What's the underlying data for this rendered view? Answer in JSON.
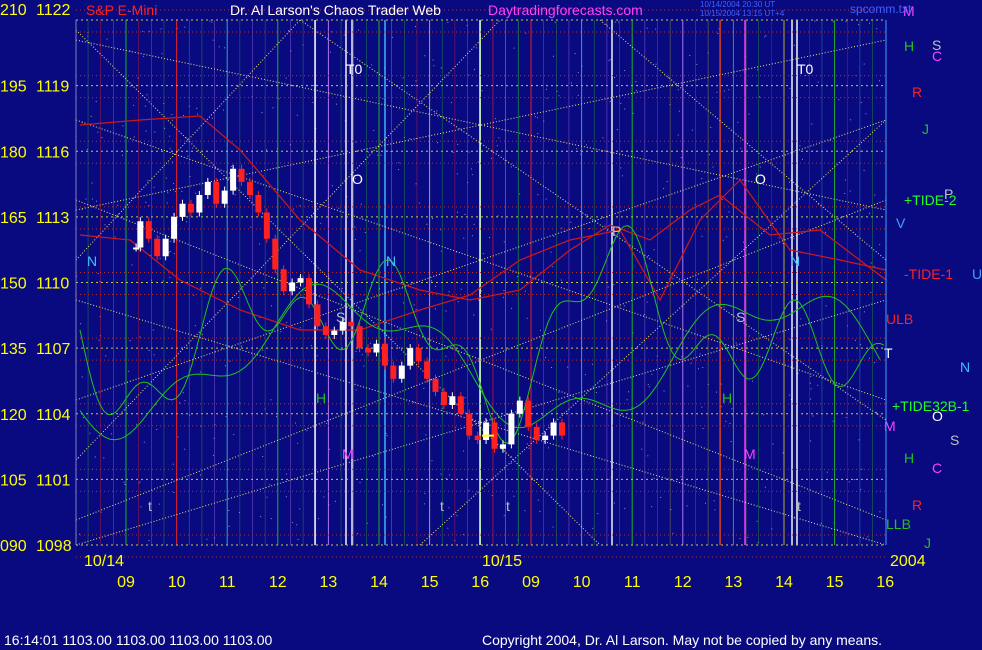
{
  "header": {
    "instrument": "S&P E-Mini",
    "title": "Dr. Al Larson's Chaos Trader Web",
    "site": "Daytradingforecasts.com",
    "file": "spcomm.txt",
    "stamp1": "10/14/2004 20:30 UT",
    "stamp2": "10/15/2004 13:15 UT+4"
  },
  "footer": {
    "quote": "16:14:01  1103.00 1103.00 1103.00 1103.00",
    "copyright": "Copyright 2004, Dr. Al Larson. May not be copied by any means."
  },
  "colors": {
    "background": "#0a0a80",
    "price_up": "#ffffff",
    "price_down": "#ff2020",
    "wave": "#20c020",
    "envelope": "#d01818",
    "diag": "#e8e870",
    "axis_text": "#ffff00"
  },
  "chart_data": {
    "type": "candlestick",
    "y_left_outer": [
      "210",
      "195",
      "180",
      "165",
      "150",
      "135",
      "120",
      "105",
      "090"
    ],
    "y_left_inner": [
      "1122",
      "1119",
      "1116",
      "1113",
      "1110",
      "1107",
      "1104",
      "1101",
      "1098"
    ],
    "ylim": [
      1098,
      1122
    ],
    "date_labels": [
      "10/14",
      "10/15",
      "2004"
    ],
    "hour_ticks": [
      "09",
      "10",
      "11",
      "12",
      "13",
      "14",
      "15",
      "16",
      "09",
      "10",
      "11",
      "12",
      "13",
      "14",
      "15",
      "16"
    ],
    "right_labels": [
      {
        "text": "M",
        "color": "#ff40ff"
      },
      {
        "text": "S",
        "color": "#c0c0c0"
      },
      {
        "text": "H",
        "color": "#20c020"
      },
      {
        "text": "C",
        "color": "#ff40ff"
      },
      {
        "text": "R",
        "color": "#ff2020"
      },
      {
        "text": "J",
        "color": "#20c020"
      },
      {
        "text": "+TIDE-2",
        "color": "#20ff20"
      },
      {
        "text": "P",
        "color": "#c0c0c0"
      },
      {
        "text": "V",
        "color": "#40a0ff"
      },
      {
        "text": "-TIDE-1",
        "color": "#ff2020"
      },
      {
        "text": "U",
        "color": "#40a0ff"
      },
      {
        "text": "ULB",
        "color": "#ff2020"
      },
      {
        "text": "T",
        "color": "#ffffff"
      },
      {
        "text": "N",
        "color": "#40c0ff"
      },
      {
        "text": "+TIDE32B-1",
        "color": "#20ff20"
      },
      {
        "text": "M",
        "color": "#ff40ff"
      },
      {
        "text": "O",
        "color": "#ffffff"
      },
      {
        "text": "S",
        "color": "#c0c0c0"
      },
      {
        "text": "H",
        "color": "#20c020"
      },
      {
        "text": "C",
        "color": "#ff40ff"
      },
      {
        "text": "R",
        "color": "#ff2020"
      },
      {
        "text": "LLB",
        "color": "#20c020"
      },
      {
        "text": "J",
        "color": "#20c020"
      }
    ],
    "in_chart_labels": [
      {
        "text": "T0",
        "color": "#ffffff"
      },
      {
        "text": "T0",
        "color": "#ffffff"
      },
      {
        "text": "O",
        "color": "#ffffff"
      },
      {
        "text": "O",
        "color": "#ffffff"
      },
      {
        "text": "N",
        "color": "#40c0ff"
      },
      {
        "text": "N",
        "color": "#40c0ff"
      },
      {
        "text": "N",
        "color": "#40c0ff"
      },
      {
        "text": "P",
        "color": "#c0c0c0"
      },
      {
        "text": "S",
        "color": "#c0c0c0"
      },
      {
        "text": "S",
        "color": "#c0c0c0"
      },
      {
        "text": "H",
        "color": "#20c020"
      },
      {
        "text": "H",
        "color": "#20c020"
      },
      {
        "text": "M",
        "color": "#ff40ff"
      },
      {
        "text": "M",
        "color": "#ff40ff"
      },
      {
        "text": "t",
        "color": "#c0c0c0"
      },
      {
        "text": "t",
        "color": "#c0c0c0"
      },
      {
        "text": "t",
        "color": "#c0c0c0"
      },
      {
        "text": "t",
        "color": "#c0c0c0"
      }
    ],
    "price_series": [
      [
        "09:30",
        1111.6
      ],
      [
        "09:35",
        1112.8
      ],
      [
        "09:45",
        1112.0
      ],
      [
        "09:55",
        1111.2
      ],
      [
        "10:05",
        1112.0
      ],
      [
        "10:15",
        1113.0
      ],
      [
        "10:25",
        1113.6
      ],
      [
        "10:35",
        1113.2
      ],
      [
        "10:45",
        1114.0
      ],
      [
        "10:55",
        1114.6
      ],
      [
        "11:05",
        1113.6
      ],
      [
        "11:15",
        1114.2
      ],
      [
        "11:25",
        1115.2
      ],
      [
        "11:35",
        1114.6
      ],
      [
        "11:45",
        1114.0
      ],
      [
        "11:55",
        1113.2
      ],
      [
        "12:05",
        1112.0
      ],
      [
        "12:15",
        1110.6
      ],
      [
        "12:25",
        1109.6
      ],
      [
        "12:35",
        1110.0
      ],
      [
        "12:45",
        1110.2
      ],
      [
        "12:55",
        1109.0
      ],
      [
        "13:05",
        1108.0
      ],
      [
        "13:15",
        1107.6
      ],
      [
        "13:25",
        1107.8
      ],
      [
        "13:35",
        1108.2
      ],
      [
        "13:45",
        1108.0
      ],
      [
        "13:55",
        1107.0
      ],
      [
        "14:05",
        1106.8
      ],
      [
        "14:15",
        1107.2
      ],
      [
        "14:25",
        1106.2
      ],
      [
        "14:35",
        1105.6
      ],
      [
        "14:45",
        1106.2
      ],
      [
        "14:55",
        1107.0
      ],
      [
        "15:05",
        1106.4
      ],
      [
        "15:15",
        1105.6
      ],
      [
        "15:25",
        1105.0
      ],
      [
        "15:35",
        1104.4
      ],
      [
        "15:45",
        1104.8
      ],
      [
        "15:55",
        1104.0
      ],
      [
        "16:05",
        1103.0
      ],
      [
        "16:15",
        1102.8
      ],
      [
        "16:25",
        1103.6
      ],
      [
        "16:35",
        1102.4
      ],
      [
        "16:45",
        1102.6
      ],
      [
        "16:55",
        1104.0
      ],
      [
        "17:05",
        1104.6
      ],
      [
        "17:15",
        1103.4
      ],
      [
        "17:25",
        1102.8
      ],
      [
        "17:35",
        1103.0
      ],
      [
        "17:45",
        1103.6
      ],
      [
        "17:55",
        1103.0
      ]
    ],
    "last_price": 1103.0
  }
}
